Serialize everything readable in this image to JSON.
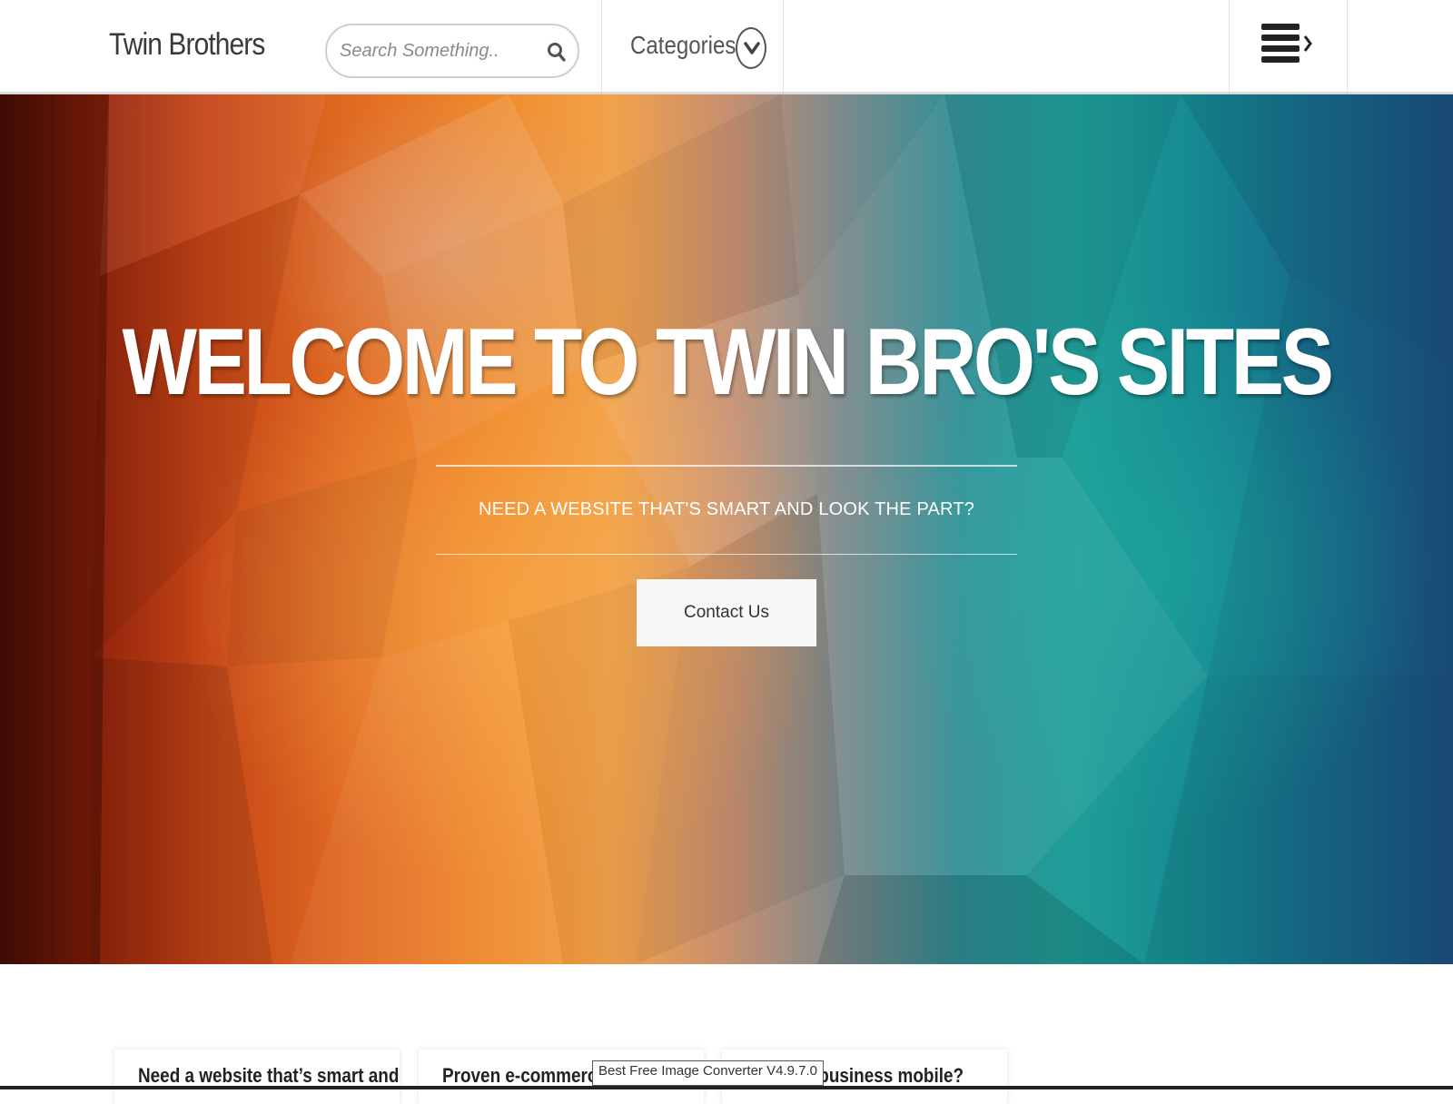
{
  "header": {
    "brand": "Twin Brothers",
    "search": {
      "placeholder": "Search Something..",
      "value": ""
    },
    "categories_label": "Categories"
  },
  "hero": {
    "title": "WELCOME TO TWIN BRO'S SITES",
    "subtitle": "NEED A WEBSITE THAT'S SMART AND LOOK THE PART?",
    "cta_label": "Contact Us"
  },
  "cards": [
    {
      "title": "Need a website that’s smart and"
    },
    {
      "title": "Proven e-commerce"
    },
    {
      "title": "your business mobile?"
    }
  ],
  "tooltip": "Best Free Image Converter V4.9.7.0",
  "icons": {
    "search": "search-icon",
    "categories_toggle": "chevron-down-icon",
    "menu": "hamburger-menu-icon"
  },
  "colors": {
    "header_bg": "#ffffff",
    "text_dark": "#333333",
    "hero_warm": "#f08a2c",
    "hero_cool": "#168a92",
    "button_bg": "#f7f7f7"
  }
}
